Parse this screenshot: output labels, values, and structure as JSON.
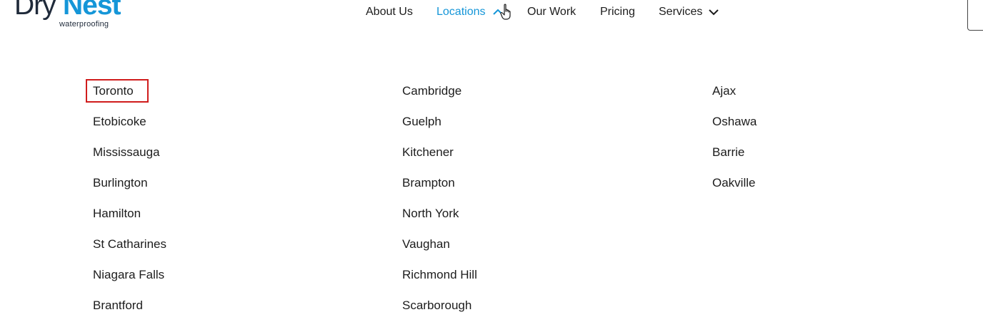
{
  "logo": {
    "primary": "Dry",
    "accent": "Nest",
    "tagline": "waterproofing"
  },
  "nav": {
    "items": [
      {
        "label": "About Us"
      },
      {
        "label": "Locations"
      },
      {
        "label": "Our Work"
      },
      {
        "label": "Pricing"
      },
      {
        "label": "Services"
      }
    ],
    "active": "Locations",
    "accent_color": "#1596d8"
  },
  "locations": {
    "columns": [
      [
        "Toronto",
        "Etobicoke",
        "Mississauga",
        "Burlington",
        "Hamilton",
        "St Catharines",
        "Niagara Falls",
        "Brantford"
      ],
      [
        "Cambridge",
        "Guelph",
        "Kitchener",
        "Brampton",
        "North York",
        "Vaughan",
        "Richmond Hill",
        "Scarborough"
      ],
      [
        "Ajax",
        "Oshawa",
        "Barrie",
        "Oakville"
      ]
    ],
    "highlighted": "Toronto",
    "highlight_color": "#d01c1c"
  }
}
